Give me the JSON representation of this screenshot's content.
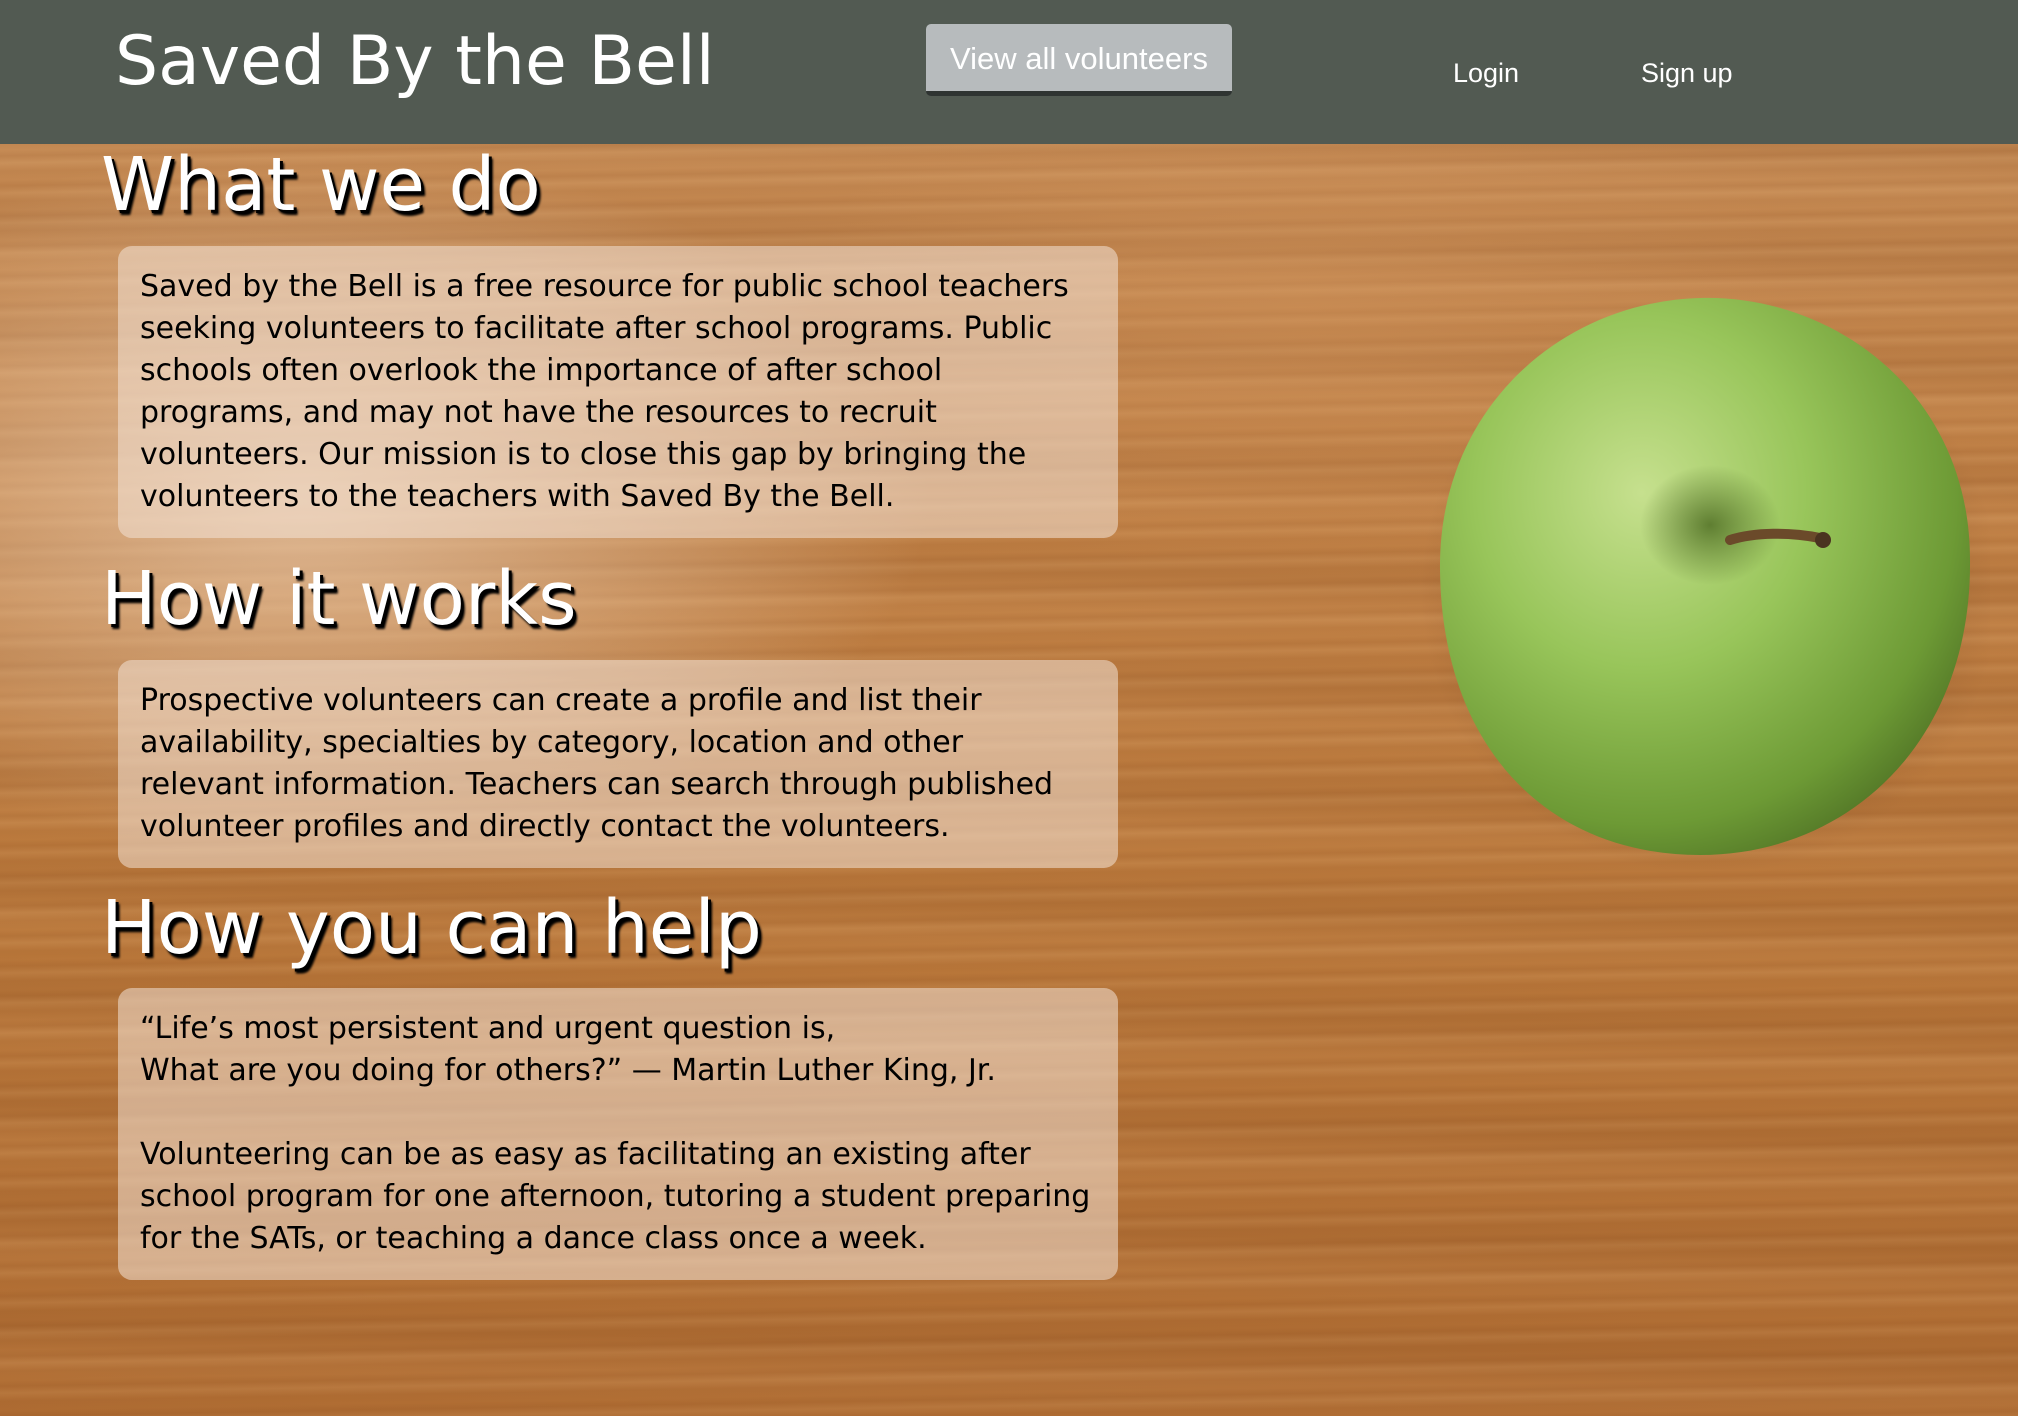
{
  "header": {
    "brand": "Saved By the Bell",
    "view_all_label": "View all volunteers",
    "login_label": "Login",
    "signup_label": "Sign up"
  },
  "sections": [
    {
      "title": "What we do",
      "body": "Saved by the Bell is a free resource for public school teachers seeking volunteers to facilitate after school programs. Public schools often overlook the importance of after school programs, and may not have the resources to recruit volunteers. Our mission is to close this gap by bringing the volunteers to the teachers with Saved By the Bell."
    },
    {
      "title": "How it works",
      "body": "Prospective volunteers can create a profile and list their availability, specialties by category, location and other relevant information. Teachers can search through published volunteer profiles and directly contact the volunteers."
    },
    {
      "title": "How you can help",
      "quote_line1": "“Life’s most persistent and urgent question is,",
      "quote_line2": "What are you doing for others?” — Martin Luther King, Jr.",
      "body": "Volunteering can be as easy as facilitating an existing after school program for one afternoon, tutoring a student preparing for the SATs, or teaching a dance class once a week."
    }
  ],
  "colors": {
    "header_bg": "#525a52",
    "button_bg": "#b7bbbd",
    "card_bg": "rgba(242,226,214,0.55)"
  },
  "background_image": "green-apple-on-wood-table"
}
